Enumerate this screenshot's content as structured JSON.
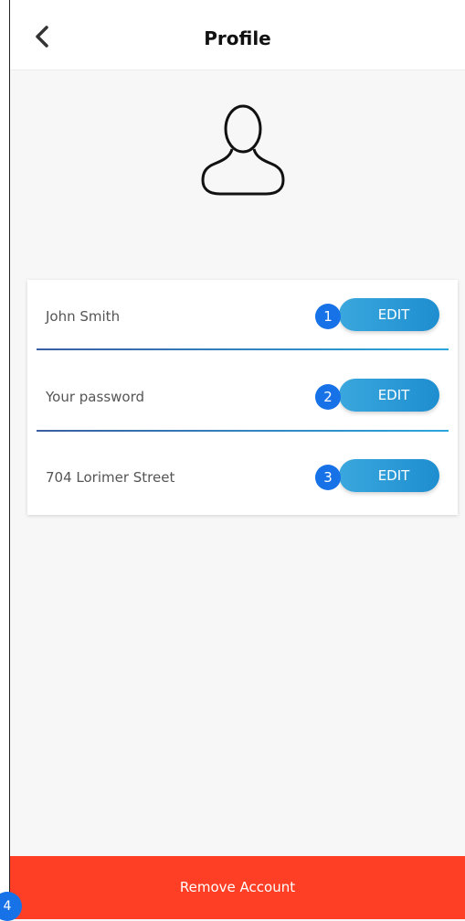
{
  "header": {
    "title": "Profile",
    "back_icon": "chevron-left-icon"
  },
  "avatar": {
    "icon": "user-outline-icon"
  },
  "profile_fields": [
    {
      "value": "John Smith",
      "button_label": "EDIT",
      "badge": "1"
    },
    {
      "value": "Your password",
      "button_label": "EDIT",
      "badge": "2"
    },
    {
      "value": "704 Lorimer Street",
      "button_label": "EDIT",
      "badge": "3"
    }
  ],
  "footer": {
    "remove_label": "Remove Account",
    "badge": "4"
  },
  "colors": {
    "accent": "#1e8ed0",
    "badge": "#1772e8",
    "danger": "#fe3f25",
    "background": "#f7f7f7"
  }
}
